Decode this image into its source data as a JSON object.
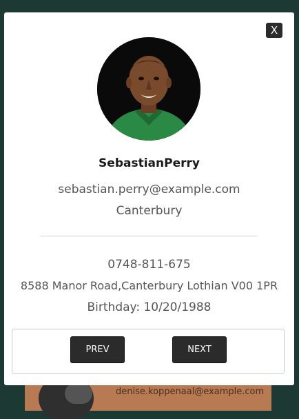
{
  "background": {
    "partial_email": "denise.koppenaal@example.com"
  },
  "modal": {
    "close_label": "X",
    "profile": {
      "name": "SebastianPerry",
      "email": "sebastian.perry@example.com",
      "city": "Canterbury",
      "phone": "0748-811-675",
      "address": "8588 Manor Road,Canterbury Lothian V00 1PR",
      "birthday": "Birthday: 10/20/1988"
    },
    "nav": {
      "prev_label": "PREV",
      "next_label": "NEXT"
    }
  },
  "colors": {
    "backdrop": "#1c3a33",
    "button_dark": "#2b2b2b",
    "text_muted": "#555555"
  }
}
